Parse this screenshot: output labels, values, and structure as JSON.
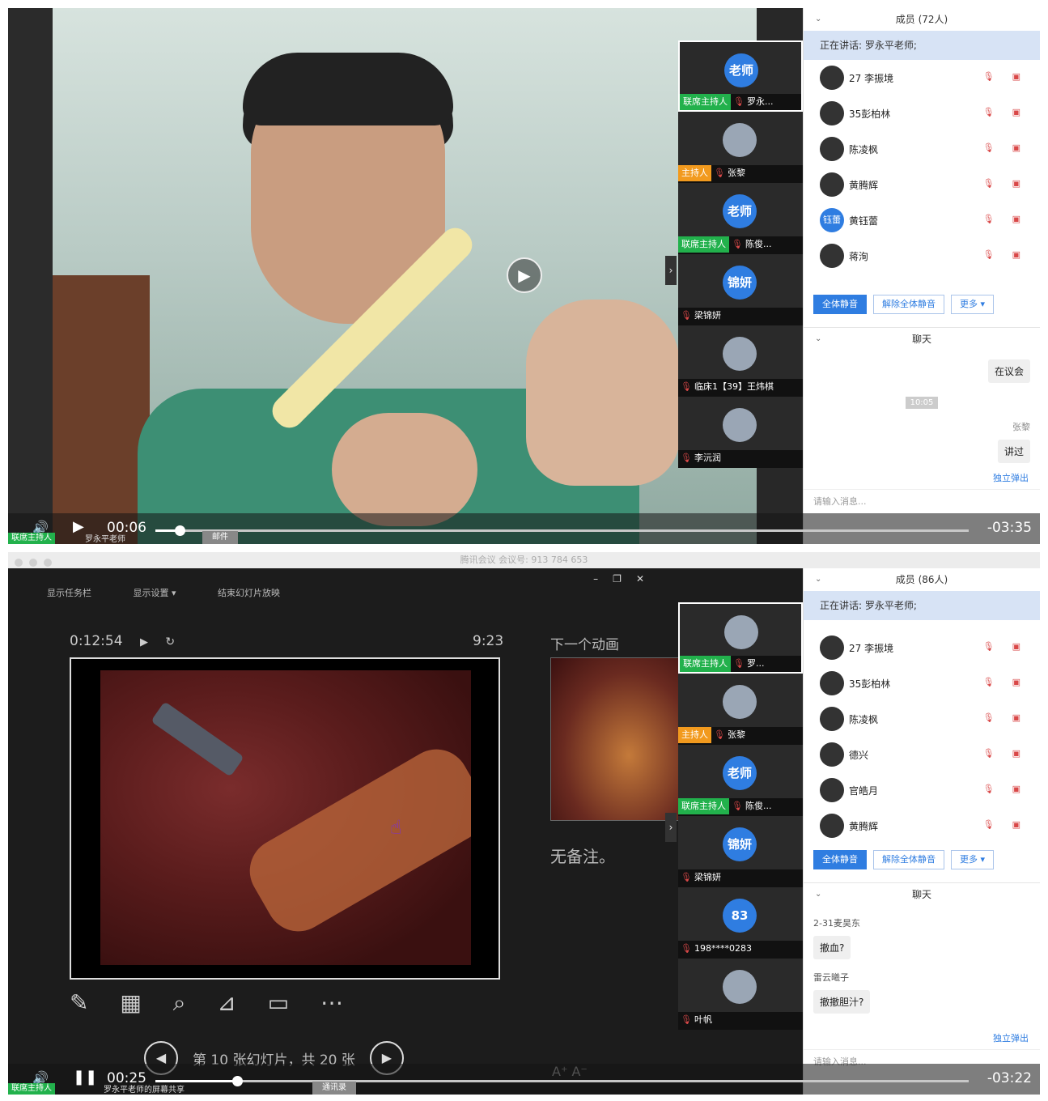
{
  "p1": {
    "thumbnails": [
      {
        "avatar": "老师",
        "tag": "联席主持人",
        "tag_color": "green",
        "name": "罗永..."
      },
      {
        "avatar": "",
        "tag": "主持人",
        "tag_color": "orange",
        "name": "张黎"
      },
      {
        "avatar": "老师",
        "tag": "联席主持人",
        "tag_color": "green",
        "name": "陈俊..."
      },
      {
        "avatar": "锦妍",
        "tag": "",
        "tag_color": "",
        "name": "梁锦妍"
      },
      {
        "avatar": "",
        "tag": "",
        "tag_color": "",
        "name": "临床1【39】王炜棋"
      },
      {
        "avatar": "",
        "tag": "",
        "tag_color": "",
        "name": "李沅润"
      }
    ],
    "members_title": "成员 (72人)",
    "speaking": "正在讲话: 罗永平老师;",
    "members": [
      {
        "name": "27 李振境",
        "avatar": ""
      },
      {
        "name": "35彭柏林",
        "avatar": ""
      },
      {
        "name": "陈凌枫",
        "avatar": ""
      },
      {
        "name": "黄腾辉",
        "avatar": ""
      },
      {
        "name": "黄钰蕾",
        "avatar": "钰蕾"
      },
      {
        "name": "蒋洵",
        "avatar": ""
      }
    ],
    "buttons": {
      "mute_all": "全体静音",
      "unmute_all": "解除全体静音",
      "more": "更多 ▾"
    },
    "chat_title": "聊天",
    "chat": {
      "bubble1": "在议会",
      "time": "10:05",
      "sender": "张黎",
      "bubble2": "讲过"
    },
    "popout": "独立弹出",
    "input_placeholder": "请输入消息...",
    "player": {
      "elapsed": "00:06",
      "remaining": "-03:35",
      "progress": 0.03
    },
    "bottom": {
      "tag": "联席主持人",
      "name": "罗永平老师",
      "btn": "邮件"
    }
  },
  "p2": {
    "title": "腾讯会议 会议号: 913 784 653",
    "toolbar": [
      "显示任务栏",
      "显示设置 ▾",
      "结束幻灯片放映"
    ],
    "timer": "0:12:54",
    "clock": "9:23",
    "next_label": "下一个动画",
    "notes": "无备注。",
    "slide_info": "第 10 张幻灯片，共 20 张",
    "thumbnails": [
      {
        "avatar": "",
        "tag": "联席主持人",
        "tag_color": "green",
        "name": "罗..."
      },
      {
        "avatar": "",
        "tag": "主持人",
        "tag_color": "orange",
        "name": "张黎"
      },
      {
        "avatar": "老师",
        "tag": "联席主持人",
        "tag_color": "green",
        "name": "陈俊..."
      },
      {
        "avatar": "锦妍",
        "tag": "",
        "tag_color": "",
        "name": "梁锦妍"
      },
      {
        "avatar": "83",
        "tag": "",
        "tag_color": "",
        "name": "198****0283"
      },
      {
        "avatar": "",
        "tag": "",
        "tag_color": "",
        "name": "叶帆"
      }
    ],
    "members_title": "成员 (86人)",
    "speaking": "正在讲话: 罗永平老师;",
    "members": [
      {
        "name": "27 李振境",
        "avatar": ""
      },
      {
        "name": "35彭柏林",
        "avatar": ""
      },
      {
        "name": "陈凌枫",
        "avatar": ""
      },
      {
        "name": "德兴",
        "avatar": ""
      },
      {
        "name": "官皓月",
        "avatar": ""
      },
      {
        "name": "黄腾辉",
        "avatar": ""
      }
    ],
    "buttons": {
      "mute_all": "全体静音",
      "unmute_all": "解除全体静音",
      "more": "更多 ▾"
    },
    "chat_title": "聊天",
    "chat": [
      {
        "sender": "2-31麦昊东",
        "text": "撤血?"
      },
      {
        "sender": "雷云曦子",
        "text": "撤撤胆汁?"
      }
    ],
    "popout": "独立弹出",
    "input_placeholder": "请输入消息...",
    "player": {
      "elapsed": "00:25",
      "remaining": "-03:22",
      "progress": 0.1
    },
    "bottom": {
      "tag": "联席主持人",
      "name": "罗永平老师的屏幕共享",
      "btn": "通讯录"
    }
  },
  "colors": {
    "accent": "#2f7de1",
    "host_green": "#22b14c",
    "host_orange": "#f29a1e",
    "mic_red": "#d94848"
  }
}
